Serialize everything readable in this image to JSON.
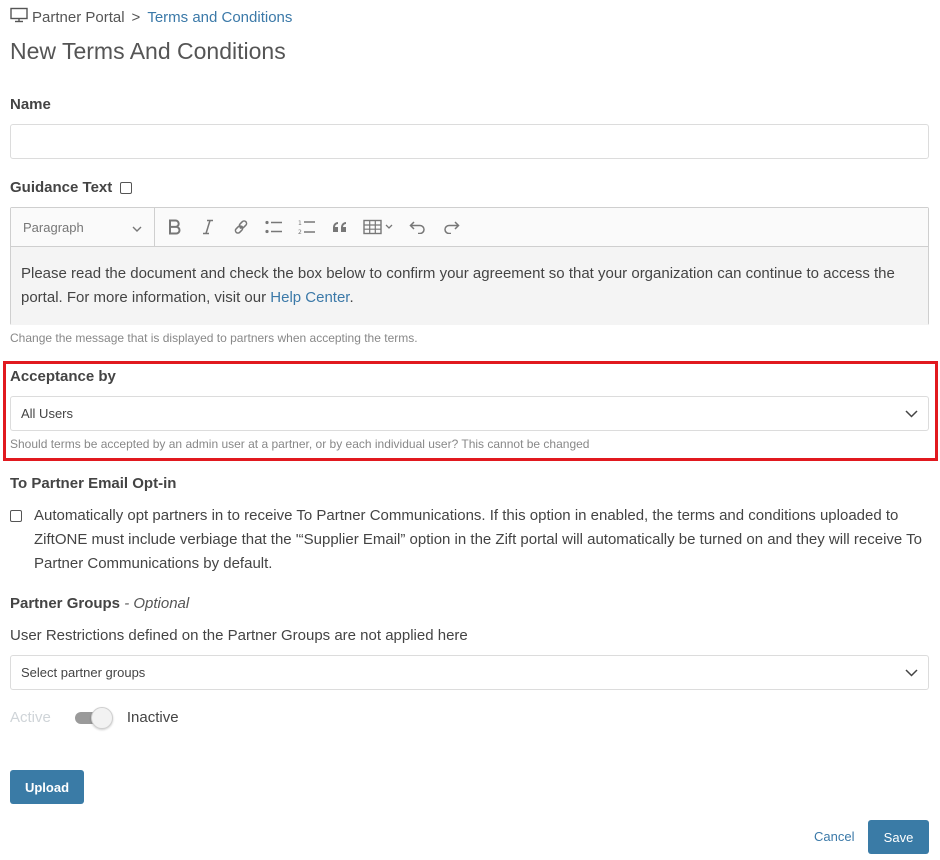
{
  "breadcrumb": {
    "root": "Partner Portal",
    "separator": ">",
    "current": "Terms and Conditions"
  },
  "page_title": "New Terms And Conditions",
  "name": {
    "label": "Name",
    "value": ""
  },
  "guidance": {
    "label": "Guidance Text",
    "paragraph_select": "Paragraph",
    "toolbar_icons": [
      "bold-icon",
      "italic-icon",
      "link-icon",
      "bulleted-list-icon",
      "numbered-list-icon",
      "blockquote-icon",
      "table-icon",
      "undo-icon",
      "redo-icon"
    ],
    "text": "Please read the document and check the box below to confirm your agreement so that your organization can continue to access the portal. For more information, visit our ",
    "link_text": "Help Center",
    "text_end": ".",
    "help": "Change the message that is displayed to partners when accepting the terms."
  },
  "acceptance": {
    "label": "Acceptance by",
    "selected": "All Users",
    "help": "Should terms be accepted by an admin user at a partner, or by each individual user? This cannot be changed",
    "highlight_color": "#e1191f"
  },
  "email_optin": {
    "label": "To Partner Email Opt-in",
    "text": "Automatically opt partners in to receive To Partner Communications. If this option in enabled, the terms and conditions uploaded to ZiftONE must include verbiage that the '“Supplier Email” option in the Zift portal will automatically be turned on and they will receive To Partner Communications by default."
  },
  "partner_groups": {
    "label": "Partner Groups",
    "optional": " - Optional",
    "note": "User Restrictions defined on the Partner Groups are not applied here",
    "placeholder": "Select partner groups"
  },
  "status_toggle": {
    "active_label": "Active",
    "inactive_label": "Inactive"
  },
  "buttons": {
    "upload": "Upload",
    "cancel": "Cancel",
    "save": "Save"
  },
  "colors": {
    "primary": "#3a7ba6",
    "link": "#3b79a8"
  }
}
